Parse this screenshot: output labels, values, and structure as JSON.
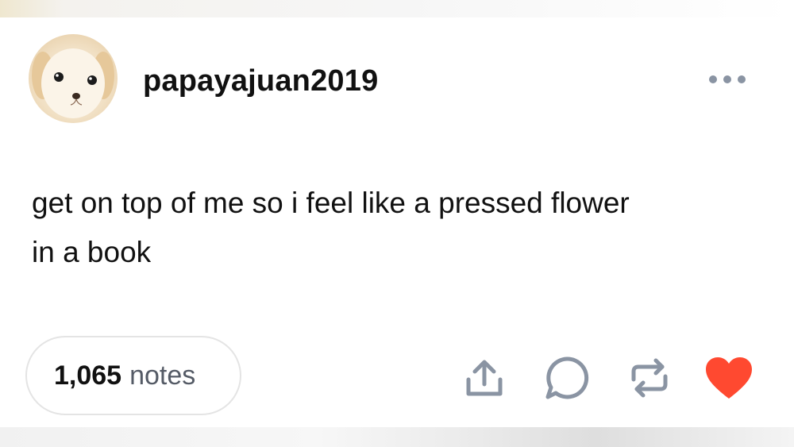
{
  "post": {
    "username": "papayajuan2019",
    "body_line1": "get on top of me so i feel like a pressed flower",
    "body_line2": "in a book",
    "notes_count": "1,065",
    "notes_label": "notes"
  },
  "icons": {
    "more": "more-horizontal-icon",
    "share": "share-icon",
    "reply": "reply-icon",
    "reblog": "reblog-icon",
    "like": "heart-icon"
  },
  "colors": {
    "icon_gray": "#8a94a3",
    "like_red": "#ff4930",
    "text": "#111111",
    "muted": "#555b66"
  }
}
